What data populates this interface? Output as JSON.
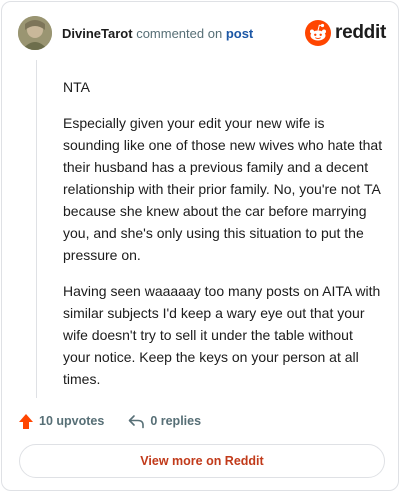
{
  "comment": {
    "author": "DivineTarot",
    "action_text": "commented on",
    "post_link": "post",
    "paragraphs": [
      "NTA",
      "Especially given your edit your new wife is sounding like one of those new wives who hate that their husband has a previous family and a decent relationship with their prior family. No, you're not TA because she knew about the car before marrying you, and she's only using this situation to put the pressure on.",
      "Having seen waaaaay too many posts on AITA with similar subjects I'd keep a wary eye out that your wife doesn't try to sell it under the table without your notice. Keep the keys on your person at all times."
    ],
    "upvotes_label": "10 upvotes",
    "replies_label": "0 replies"
  },
  "brand": {
    "logo_text": "reddit",
    "accent": "#ff4500"
  },
  "footer": {
    "view_more_label": "View more on Reddit"
  },
  "icons": {
    "avatar": "avatar",
    "logo": "reddit-logo-icon",
    "upvote": "upvote-arrow-icon",
    "reply": "reply-arrow-icon"
  }
}
